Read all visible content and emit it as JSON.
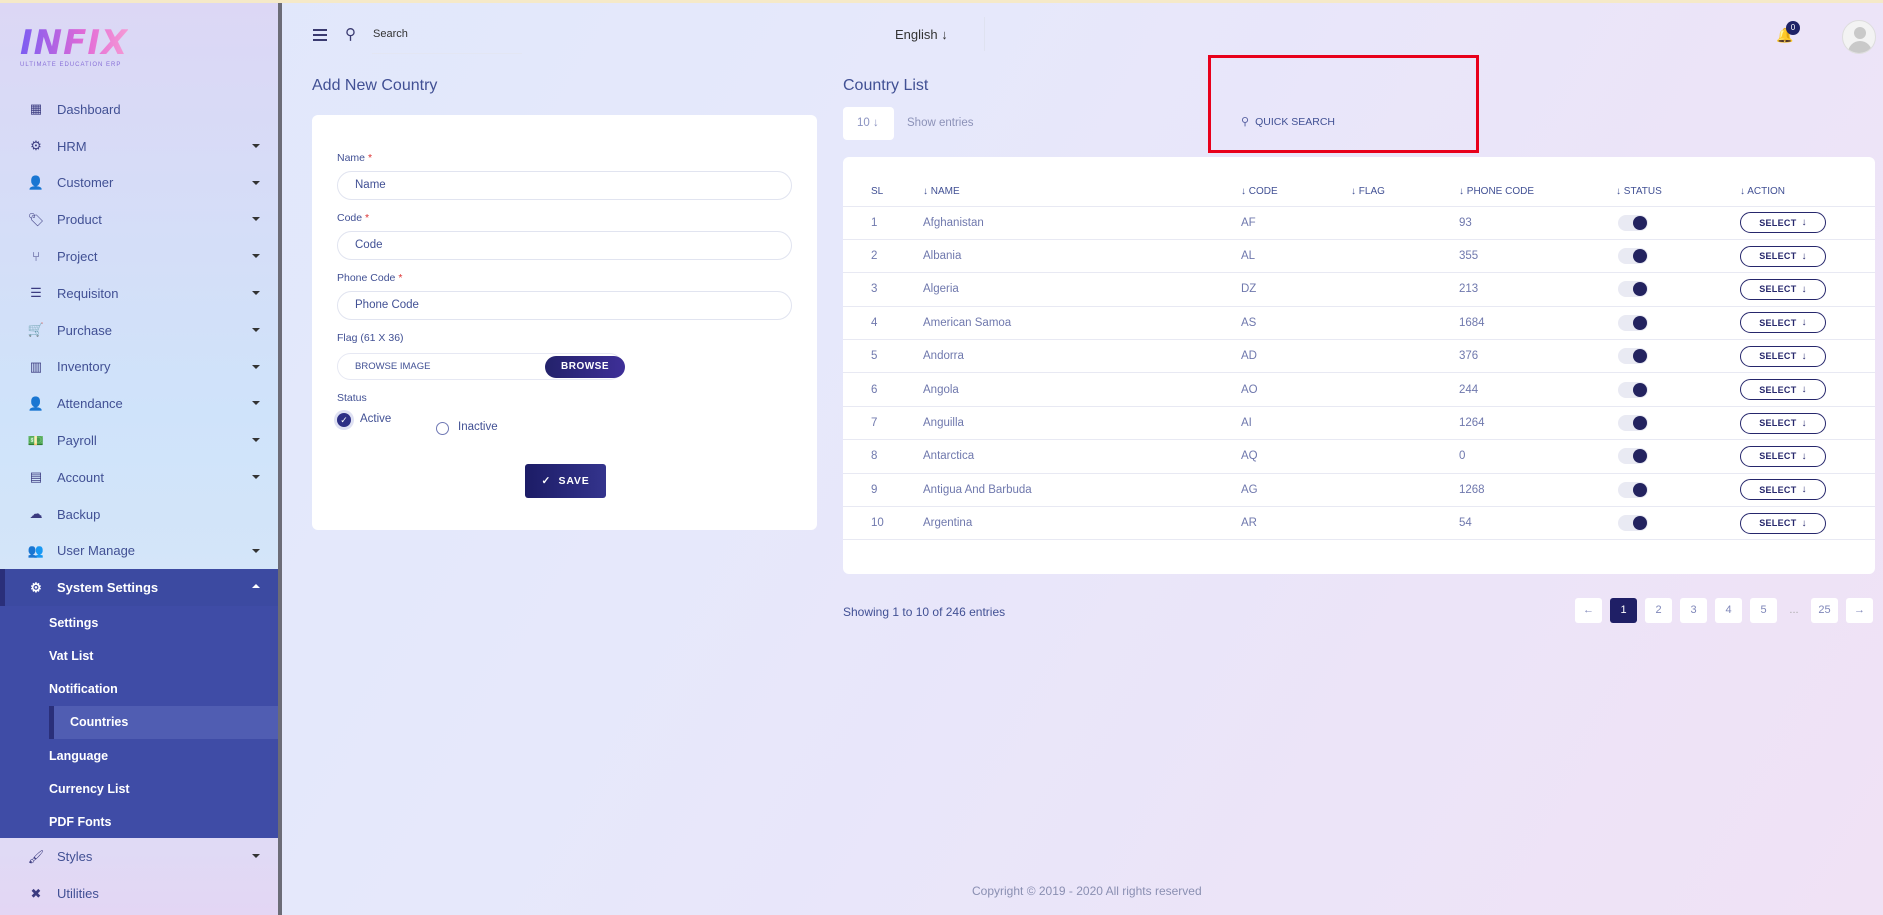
{
  "brand": {
    "logo_text": "INFIX",
    "logo_tagline": "ULTIMATE EDUCATION ERP"
  },
  "sidebar": {
    "items": [
      {
        "label": "Dashboard",
        "icon": "grid-icon",
        "has_caret": false
      },
      {
        "label": "HRM",
        "icon": "users-cog-icon",
        "has_caret": true
      },
      {
        "label": "Customer",
        "icon": "user-icon",
        "has_caret": true
      },
      {
        "label": "Product",
        "icon": "tags-icon",
        "has_caret": true
      },
      {
        "label": "Project",
        "icon": "project-diagram-icon",
        "has_caret": true
      },
      {
        "label": "Requisiton",
        "icon": "list-icon",
        "has_caret": true
      },
      {
        "label": "Purchase",
        "icon": "cart-icon",
        "has_caret": true
      },
      {
        "label": "Inventory",
        "icon": "barcode-icon",
        "has_caret": true
      },
      {
        "label": "Attendance",
        "icon": "user-plus-icon",
        "has_caret": true
      },
      {
        "label": "Payroll",
        "icon": "money-icon",
        "has_caret": true
      },
      {
        "label": "Account",
        "icon": "calculator-icon",
        "has_caret": true
      },
      {
        "label": "Backup",
        "icon": "cloud-download-icon",
        "has_caret": false
      },
      {
        "label": "User Manage",
        "icon": "users-icon",
        "has_caret": true
      },
      {
        "label": "System Settings",
        "icon": "gear-icon",
        "has_caret": true
      }
    ],
    "submenu": [
      "Settings",
      "Vat List",
      "Notification",
      "Countries",
      "Language",
      "Currency List",
      "PDF Fonts"
    ],
    "bottom_items": [
      {
        "label": "Styles",
        "icon": "brush-icon",
        "has_caret": true
      },
      {
        "label": "Utilities",
        "icon": "tools-icon",
        "has_caret": false
      }
    ]
  },
  "topbar": {
    "search_placeholder": "Search",
    "language": "English",
    "notification_count": "0"
  },
  "form": {
    "title": "Add New Country",
    "name_label": "Name",
    "name_placeholder": "Name",
    "code_label": "Code",
    "code_placeholder": "Code",
    "phone_label": "Phone Code",
    "phone_placeholder": "Phone Code",
    "flag_label": "Flag (61 X 36)",
    "browse_placeholder": "BROWSE IMAGE",
    "browse_button": "BROWSE",
    "status_label": "Status",
    "active_label": "Active",
    "inactive_label": "Inactive",
    "save_button": "SAVE",
    "required_mark": "*"
  },
  "list": {
    "title": "Country List",
    "per_page": "10",
    "show_entries": "Show entries",
    "quick_search": "QUICK SEARCH",
    "columns": [
      "SL",
      "NAME",
      "CODE",
      "FLAG",
      "PHONE CODE",
      "STATUS",
      "ACTION"
    ],
    "rows": [
      {
        "sl": "1",
        "name": "Afghanistan",
        "code": "AF",
        "phone": "93"
      },
      {
        "sl": "2",
        "name": "Albania",
        "code": "AL",
        "phone": "355"
      },
      {
        "sl": "3",
        "name": "Algeria",
        "code": "DZ",
        "phone": "213"
      },
      {
        "sl": "4",
        "name": "American Samoa",
        "code": "AS",
        "phone": "1684"
      },
      {
        "sl": "5",
        "name": "Andorra",
        "code": "AD",
        "phone": "376"
      },
      {
        "sl": "6",
        "name": "Angola",
        "code": "AO",
        "phone": "244"
      },
      {
        "sl": "7",
        "name": "Anguilla",
        "code": "AI",
        "phone": "1264"
      },
      {
        "sl": "8",
        "name": "Antarctica",
        "code": "AQ",
        "phone": "0"
      },
      {
        "sl": "9",
        "name": "Antigua And Barbuda",
        "code": "AG",
        "phone": "1268"
      },
      {
        "sl": "10",
        "name": "Argentina",
        "code": "AR",
        "phone": "54"
      }
    ],
    "select_label": "SELECT",
    "showing_text": "Showing 1 to 10 of 246 entries",
    "pages": [
      "1",
      "2",
      "3",
      "4",
      "5",
      "...",
      "25"
    ],
    "current_page": "1"
  },
  "footer": "Copyright © 2019 - 2020 All rights reserved",
  "colors": {
    "accent": "#415094",
    "dark_button": "#1f1f66",
    "sidebar_active": "#3c4aa1",
    "highlight_box": "#e8001b"
  }
}
